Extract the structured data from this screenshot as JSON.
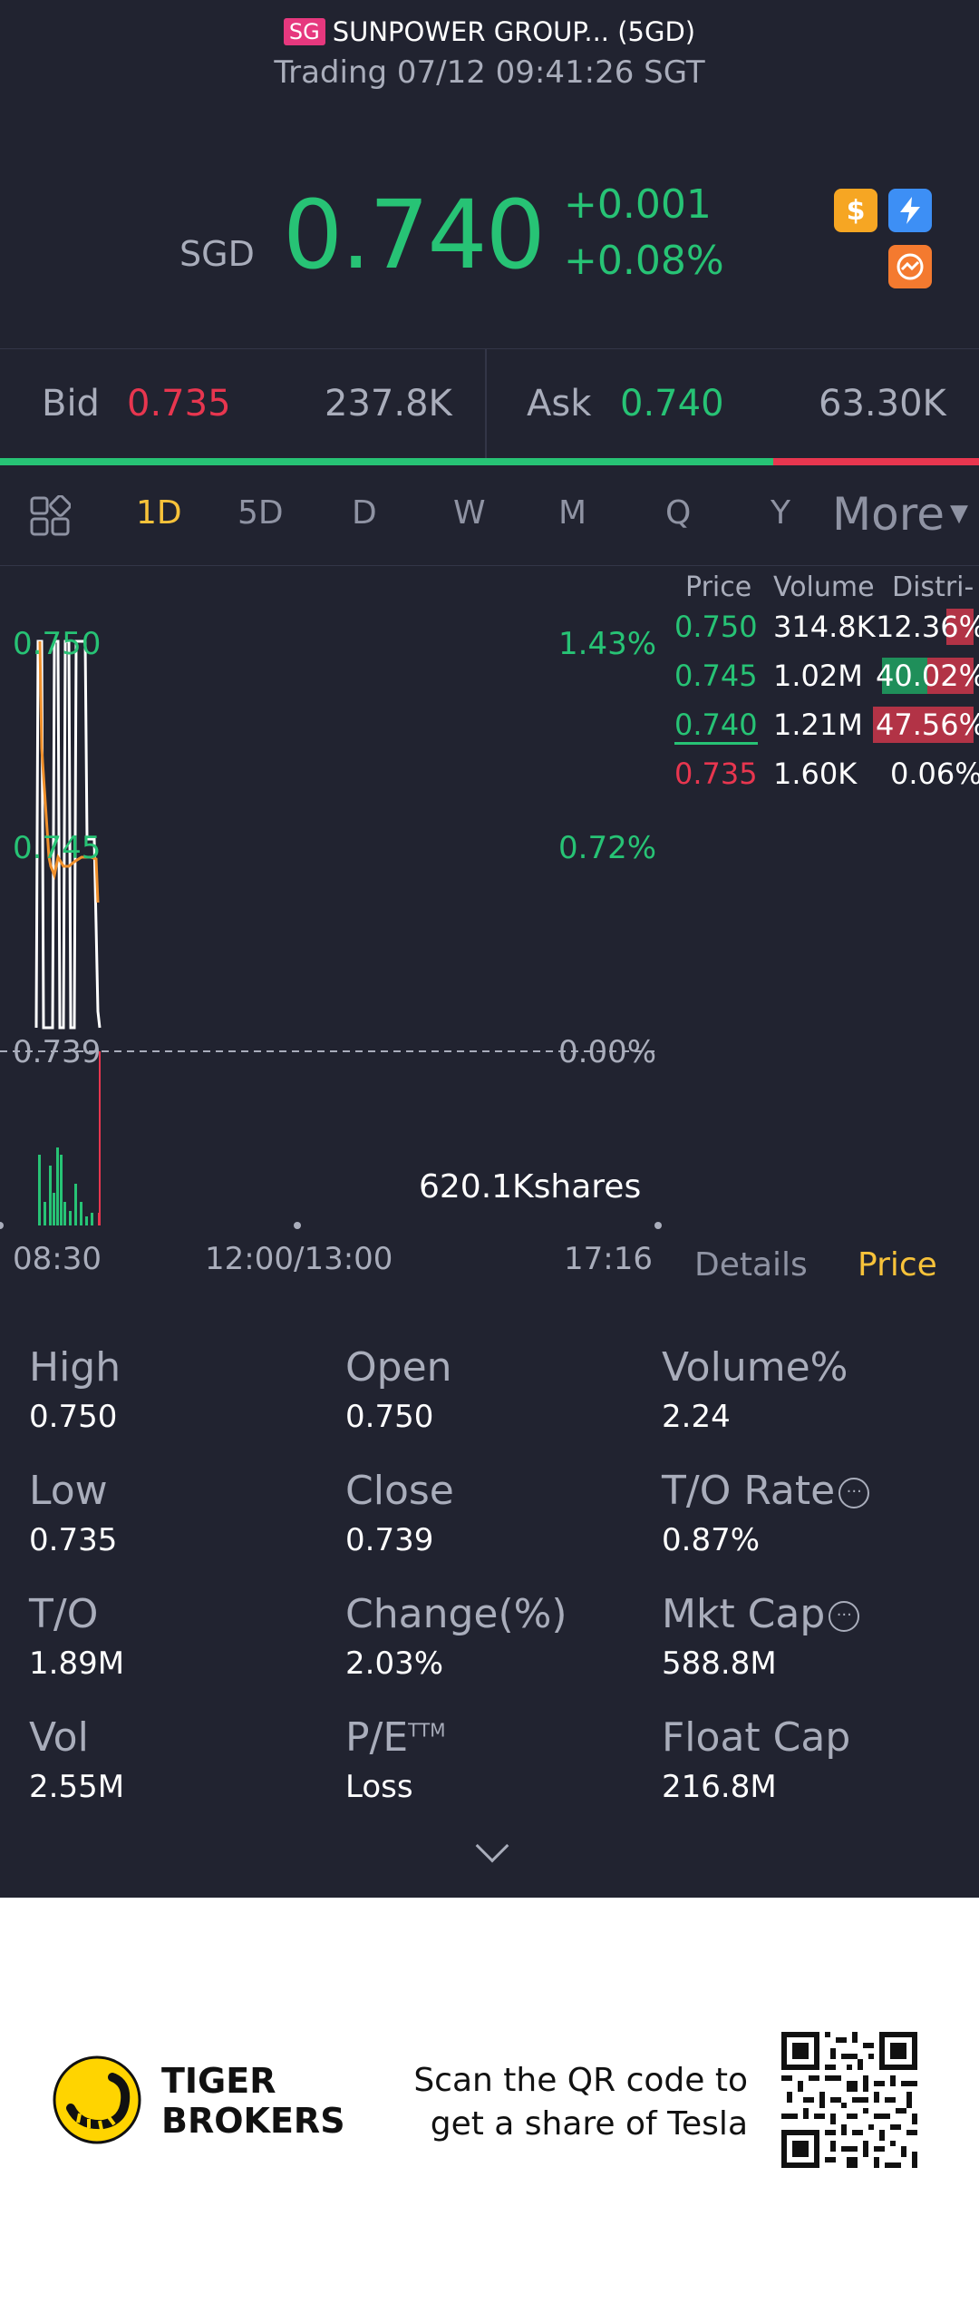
{
  "header": {
    "market_badge": "SG",
    "stock_name": "SUNPOWER GROUP... (5GD)",
    "trading_status": "Trading 07/12 09:41:26 SGT"
  },
  "quote": {
    "currency": "SGD",
    "price": "0.740",
    "change": "+0.001",
    "change_pct": "+0.08%",
    "icons": [
      "dollar-icon",
      "flash-icon",
      "activity-icon"
    ],
    "colors": {
      "up": "#27c375",
      "down": "#e8364f",
      "accent": "#f7c23a",
      "background": "#212330"
    }
  },
  "bid_ask": {
    "bid_label": "Bid",
    "bid_price": "0.735",
    "bid_size": "237.8K",
    "ask_label": "Ask",
    "ask_price": "0.740",
    "ask_size": "63.30K",
    "bid_ratio": 0.79
  },
  "tabs": {
    "items": [
      "1D",
      "5D",
      "D",
      "W",
      "M",
      "Q",
      "Y"
    ],
    "active": "1D",
    "more": "More"
  },
  "chart": {
    "price_labels": [
      "0.750",
      "0.745",
      "0.739"
    ],
    "pct_labels": [
      "1.43%",
      "0.72%",
      "0.00%"
    ],
    "volume_label": "620.1Kshares",
    "time_labels": [
      "08:30",
      "12:00/13:00",
      "17:16"
    ]
  },
  "distribution": {
    "headers": [
      "Price",
      "Volume",
      "Distri-"
    ],
    "rows": [
      {
        "price": "0.750",
        "volume": "314.8K",
        "dist": "12.36%",
        "share": 0.1236,
        "dir": "down"
      },
      {
        "price": "0.745",
        "volume": "1.02M",
        "dist": "40.02%",
        "share": 0.4002,
        "dir": "mixed"
      },
      {
        "price": "0.740",
        "volume": "1.21M",
        "dist": "47.56%",
        "share": 0.4756,
        "dir": "down"
      },
      {
        "price": "0.735",
        "volume": "1.60K",
        "dist": "0.06%",
        "share": 0.0006,
        "dir": "down"
      }
    ]
  },
  "sub_tabs": {
    "details": "Details",
    "price": "Price"
  },
  "stats": {
    "high": {
      "label": "High",
      "value": "0.750"
    },
    "open": {
      "label": "Open",
      "value": "0.750"
    },
    "volume_pct": {
      "label": "Volume%",
      "value": "2.24"
    },
    "low": {
      "label": "Low",
      "value": "0.735"
    },
    "close": {
      "label": "Close",
      "value": "0.739"
    },
    "to_rate": {
      "label": "T/O Rate",
      "value": "0.87%"
    },
    "turnover": {
      "label": "T/O",
      "value": "1.89M"
    },
    "change_pct": {
      "label": "Change(%)",
      "value": "2.03%"
    },
    "mkt_cap": {
      "label": "Mkt Cap",
      "value": "588.8M"
    },
    "vol": {
      "label": "Vol",
      "value": "2.55M"
    },
    "pe": {
      "label": "P/E",
      "sup": "TTM",
      "value": "Loss"
    },
    "float_cap": {
      "label": "Float Cap",
      "value": "216.8M"
    }
  },
  "footer": {
    "brand_line1": "TIGER",
    "brand_line2": "BROKERS",
    "promo_line1": "Scan the QR code to",
    "promo_line2": "get a share of Tesla"
  }
}
